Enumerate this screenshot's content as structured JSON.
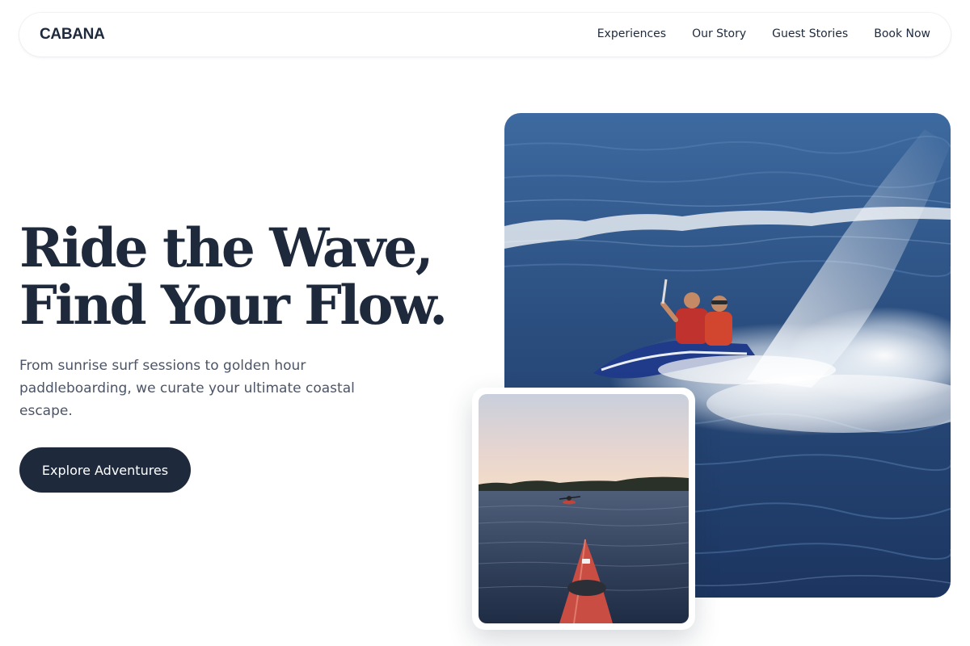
{
  "brand": {
    "name": "CABANA"
  },
  "nav": {
    "links": [
      "Experiences",
      "Our Story",
      "Guest Stories",
      "Book Now"
    ]
  },
  "hero": {
    "heading_line1": "Ride the Wave,",
    "heading_line2": "Find Your Flow.",
    "subtitle": "From sunrise surf sessions to golden hour paddleboarding, we curate your ultimate coastal escape.",
    "cta_label": "Explore Adventures"
  },
  "images": {
    "main": "jet-ski-ride-on-ocean-photo",
    "secondary": "kayak-on-lake-at-sunset-photo"
  },
  "colors": {
    "primary": "#1e2a3c",
    "text_muted": "#4b5567",
    "background": "#ffffff",
    "ocean": "#2a4d7e",
    "kayak": "#d14a3f"
  }
}
